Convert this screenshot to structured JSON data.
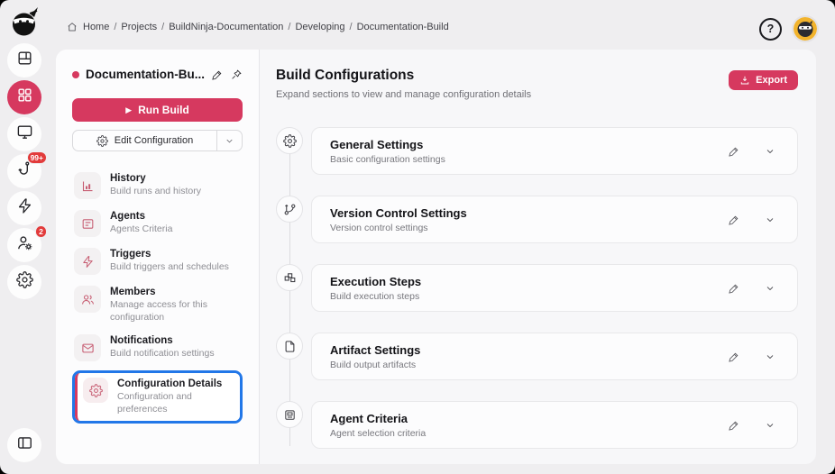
{
  "colors": {
    "accent": "#d6395f",
    "selection_outline": "#2277e8",
    "badge": "#e23b3b",
    "avatar_bg": "#f2b32c"
  },
  "topbar": {
    "separator": "/",
    "breadcrumb": [
      "Home",
      "Projects",
      "BuildNinja-Documentation",
      "Developing",
      "Documentation-Build"
    ],
    "help_label": "?",
    "icons": [
      "home-icon",
      "help-circle-icon",
      "ninja-avatar"
    ]
  },
  "rail": {
    "items": [
      {
        "icon": "layout-dashboard-icon",
        "active": false,
        "badge": ""
      },
      {
        "icon": "grid-apps-icon",
        "active": true,
        "badge": ""
      },
      {
        "icon": "monitor-icon",
        "active": false,
        "badge": ""
      },
      {
        "icon": "hook-icon",
        "active": false,
        "badge": "99+"
      },
      {
        "icon": "lightning-icon",
        "active": false,
        "badge": ""
      },
      {
        "icon": "user-gear-icon",
        "active": false,
        "badge": "2"
      },
      {
        "icon": "gear-icon",
        "active": false,
        "badge": ""
      }
    ],
    "bottom_icon": "collapse-panel-icon"
  },
  "sidebar": {
    "config_title": "Documentation-Bu...",
    "title_actions": [
      "edit-pencil-icon",
      "pin-icon"
    ],
    "run_build_label": "Run Build",
    "run_build_glyph": "▶",
    "edit_config_label": "Edit Configuration",
    "items": [
      {
        "icon": "history-chart-icon",
        "title": "History",
        "subtitle": "Build runs and history",
        "selected": false
      },
      {
        "icon": "agents-card-icon",
        "title": "Agents",
        "subtitle": "Agents Criteria",
        "selected": false
      },
      {
        "icon": "trigger-bolt-icon",
        "title": "Triggers",
        "subtitle": "Build triggers and schedules",
        "selected": false
      },
      {
        "icon": "members-icon",
        "title": "Members",
        "subtitle": "Manage access for this configuration",
        "selected": false
      },
      {
        "icon": "mail-icon",
        "title": "Notifications",
        "subtitle": "Build notification settings",
        "selected": false
      },
      {
        "icon": "gear-icon",
        "title": "Configuration Details",
        "subtitle": "Configuration and preferences",
        "selected": true
      }
    ]
  },
  "main": {
    "title": "Build Configurations",
    "subtitle": "Expand sections to view and manage configuration details",
    "export_label": "Export",
    "cards": [
      {
        "icon": "gear-icon",
        "title": "General Settings",
        "subtitle": "Basic configuration settings"
      },
      {
        "icon": "git-branch-icon",
        "title": "Version Control Settings",
        "subtitle": "Version control settings"
      },
      {
        "icon": "steps-icon",
        "title": "Execution Steps",
        "subtitle": "Build execution steps"
      },
      {
        "icon": "file-icon",
        "title": "Artifact Settings",
        "subtitle": "Build output artifacts"
      },
      {
        "icon": "agent-criteria-icon",
        "title": "Agent Criteria",
        "subtitle": "Agent selection criteria"
      }
    ]
  }
}
